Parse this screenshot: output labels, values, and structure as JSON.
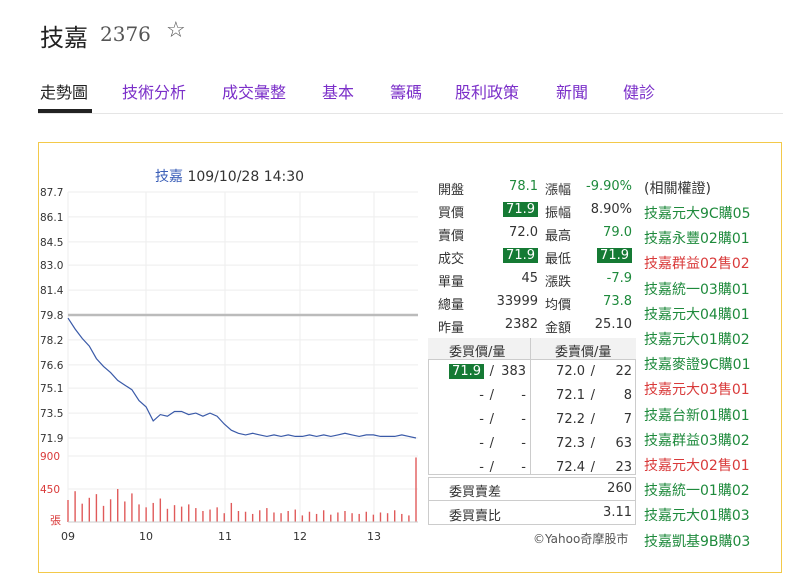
{
  "header": {
    "name": "技嘉",
    "code": "2376",
    "star_icon": "star-outline-icon"
  },
  "tabs": [
    {
      "label": "走勢圖",
      "active": true
    },
    {
      "label": "技術分析"
    },
    {
      "label": "成交彙整"
    },
    {
      "label": "基本"
    },
    {
      "label": "籌碼"
    },
    {
      "label": "股利政策"
    },
    {
      "label": "新聞"
    },
    {
      "label": "健診"
    }
  ],
  "chart": {
    "title_name": "技嘉",
    "title_time": "109/10/28 14:30"
  },
  "chart_data": {
    "type": "line",
    "ylim": [
      71.9,
      87.7
    ],
    "y_ticks": [
      "87.7",
      "86.1",
      "84.5",
      "83.0",
      "81.4",
      "79.8",
      "78.2",
      "76.6",
      "75.1",
      "73.5",
      "71.9"
    ],
    "reference_price": 79.8,
    "x_ticks": [
      "09",
      "10",
      "11",
      "12",
      "13"
    ],
    "volume_ticks": [
      "900",
      "450",
      "張"
    ],
    "series": [
      {
        "values": [
          79.6,
          78.9,
          78.3,
          77.8,
          77.0,
          76.5,
          76.1,
          75.6,
          75.3,
          75.0,
          74.3,
          73.9,
          73.0,
          73.4,
          73.3,
          73.6,
          73.6,
          73.4,
          73.5,
          73.3,
          73.5,
          73.3,
          72.8,
          72.4,
          72.2,
          72.1,
          72.2,
          72.1,
          72.0,
          72.1,
          72.0,
          72.1,
          72.0,
          72.0,
          72.1,
          72.0,
          72.1,
          72.0,
          72.1,
          72.2,
          72.1,
          72.0,
          72.1,
          72.1,
          72.0,
          72.0,
          72.0,
          72.1,
          72.0,
          71.9
        ]
      }
    ],
    "volume": [
      300,
      420,
      250,
      330,
      380,
      220,
      310,
      450,
      280,
      390,
      240,
      200,
      260,
      320,
      180,
      230,
      210,
      240,
      190,
      150,
      170,
      200,
      120,
      260,
      150,
      140,
      110,
      160,
      190,
      130,
      120,
      150,
      170,
      90,
      140,
      110,
      160,
      100,
      130,
      150,
      120,
      110,
      140,
      100,
      130,
      120,
      160,
      110,
      90,
      880
    ]
  },
  "quote": {
    "left": [
      {
        "label": "開盤",
        "value": "78.1",
        "style": "green"
      },
      {
        "label": "買價",
        "value": "71.9",
        "style": "boxg"
      },
      {
        "label": "賣價",
        "value": "72.0",
        "style": "plain"
      },
      {
        "label": "成交",
        "value": "71.9",
        "style": "boxg"
      },
      {
        "label": "單量",
        "value": "45",
        "style": "plain"
      },
      {
        "label": "總量",
        "value": "33999",
        "style": "plain"
      },
      {
        "label": "昨量",
        "value": "2382",
        "style": "plain"
      }
    ],
    "right": [
      {
        "label": "漲幅",
        "value": "-9.90%",
        "style": "green"
      },
      {
        "label": "振幅",
        "value": "8.90%",
        "style": "plain"
      },
      {
        "label": "最高",
        "value": "79.0",
        "style": "green"
      },
      {
        "label": "最低",
        "value": "71.9",
        "style": "boxg"
      },
      {
        "label": "漲跌",
        "value": "-7.9",
        "style": "green"
      },
      {
        "label": "均價",
        "value": "73.8",
        "style": "green"
      },
      {
        "label": "金額",
        "value": "25.10",
        "style": "plain"
      }
    ]
  },
  "orderbook": {
    "bid_header": "委買價/量",
    "ask_header": "委賣價/量",
    "rows": [
      {
        "bid_price": "71.9",
        "bid_vol": "383",
        "ask_price": "72.0",
        "ask_vol": "22"
      },
      {
        "bid_price": "-",
        "bid_vol": "-",
        "ask_price": "72.1",
        "ask_vol": "8"
      },
      {
        "bid_price": "-",
        "bid_vol": "-",
        "ask_price": "72.2",
        "ask_vol": "7"
      },
      {
        "bid_price": "-",
        "bid_vol": "-",
        "ask_price": "72.3",
        "ask_vol": "63"
      },
      {
        "bid_price": "-",
        "bid_vol": "-",
        "ask_price": "72.4",
        "ask_vol": "23"
      }
    ],
    "diff_label": "委買賣差",
    "diff_value": "260",
    "ratio_label": "委買賣比",
    "ratio_value": "3.11"
  },
  "warrants": {
    "title": "(相關權證)",
    "items": [
      {
        "label": "技嘉元大9C購05",
        "color": "#1e8a3c"
      },
      {
        "label": "技嘉永豐02購01",
        "color": "#1e8a3c"
      },
      {
        "label": "技嘉群益02售02",
        "color": "#d93a3a"
      },
      {
        "label": "技嘉統一03購01",
        "color": "#1e8a3c"
      },
      {
        "label": "技嘉元大04購01",
        "color": "#1e8a3c"
      },
      {
        "label": "技嘉元大01購02",
        "color": "#1e8a3c"
      },
      {
        "label": "技嘉麥證9C購01",
        "color": "#1e8a3c"
      },
      {
        "label": "技嘉元大03售01",
        "color": "#d93a3a"
      },
      {
        "label": "技嘉台新01購01",
        "color": "#1e8a3c"
      },
      {
        "label": "技嘉群益03購02",
        "color": "#1e8a3c"
      },
      {
        "label": "技嘉元大02售01",
        "color": "#d93a3a"
      },
      {
        "label": "技嘉統一01購02",
        "color": "#1e8a3c"
      },
      {
        "label": "技嘉元大01購03",
        "color": "#1e8a3c"
      },
      {
        "label": "技嘉凱基9B購03",
        "color": "#1e8a3c"
      }
    ]
  },
  "credit": "©Yahoo奇摩股市"
}
